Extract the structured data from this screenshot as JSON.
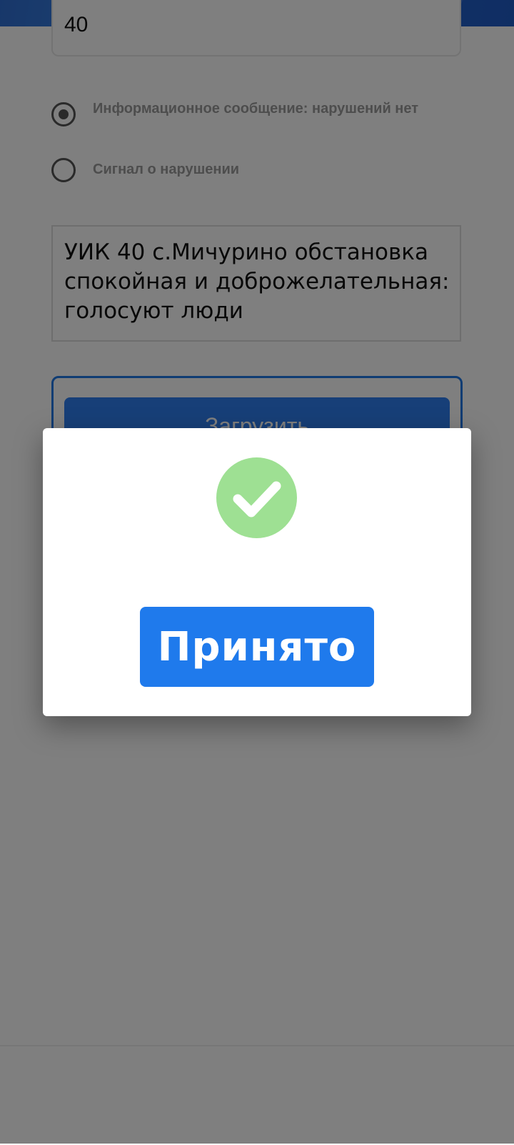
{
  "form": {
    "number_value": "40",
    "radio_options": [
      {
        "label": "Информационное сообщение: нарушений нет",
        "selected": true
      },
      {
        "label": "Сигнал о нарушении",
        "selected": false
      }
    ],
    "message_text": "УИК 40 с.Мичурино обстановка спокойная и доброжелательная: голосуют люди",
    "upload_label": "Загрузить"
  },
  "dialog": {
    "icon": "check-circle-icon",
    "accept_label": "Принято"
  },
  "colors": {
    "accent": "#1f7aec",
    "success": "#9ee093",
    "header": "#2f6fd4"
  }
}
